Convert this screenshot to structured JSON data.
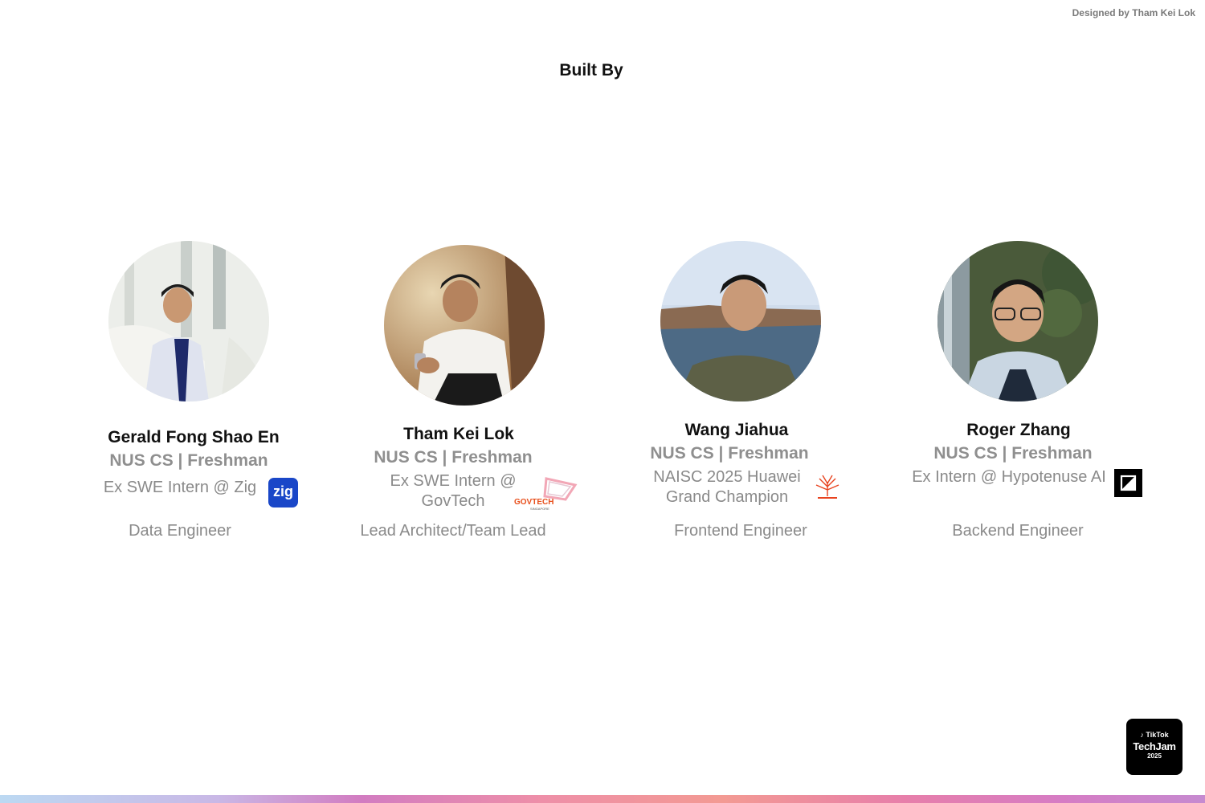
{
  "header": {
    "credit": "Designed by Tham Kei Lok",
    "title": "Built By"
  },
  "members": [
    {
      "name": "Gerald Fong Shao En",
      "school": "NUS CS | Freshman",
      "experience": "Ex SWE Intern @ Zig",
      "logo_label": "zig",
      "role": "Data Engineer"
    },
    {
      "name": "Tham Kei Lok",
      "school": "NUS CS | Freshman",
      "experience": "Ex SWE Intern @ GovTech",
      "logo_label": "GOVTECH",
      "logo_sub": "SINGAPORE",
      "role": "Lead Architect/Team Lead"
    },
    {
      "name": "Wang Jiahua",
      "school": "NUS CS | Freshman",
      "experience": "NAISC 2025 Huawei Grand Champion",
      "role": "Frontend Engineer"
    },
    {
      "name": "Roger Zhang",
      "school": "NUS CS | Freshman",
      "experience": "Ex Intern @ Hypotenuse AI",
      "role": "Backend Engineer"
    }
  ],
  "badge": {
    "brand": "TikTok",
    "event": "TechJam",
    "year": "2025"
  },
  "colors": {
    "zig_blue": "#1a47c8",
    "govtech_orange": "#e8501d",
    "huawei_red": "#e8431f"
  }
}
